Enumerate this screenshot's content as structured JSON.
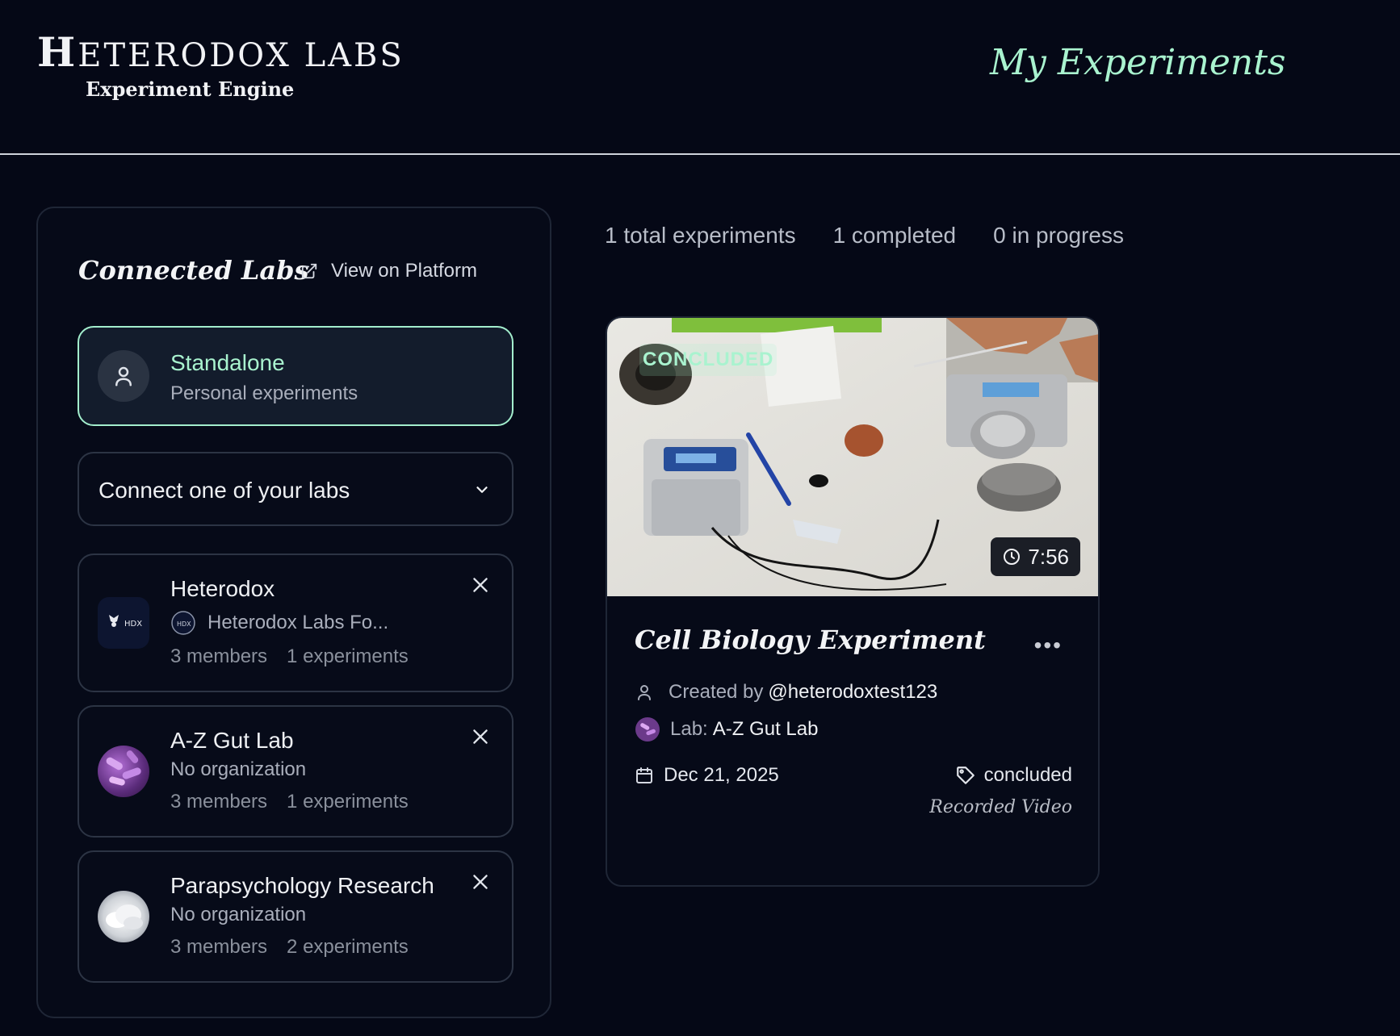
{
  "header": {
    "logo_initial": "H",
    "logo_rest": "ETERODOX LABS",
    "logo_subtitle": "Experiment Engine",
    "page_title": "My Experiments"
  },
  "sidebar": {
    "title": "Connected Labs",
    "view_platform": "View on Platform",
    "standalone": {
      "name": "Standalone",
      "subtitle": "Personal experiments"
    },
    "connect_placeholder": "Connect one of your labs",
    "labs": [
      {
        "name": "Heterodox",
        "org": "Heterodox Labs Fo...",
        "members": "3 members",
        "experiments": "1 experiments",
        "logo_text": "HDX"
      },
      {
        "name": "A-Z Gut Lab",
        "org": "No organization",
        "members": "3 members",
        "experiments": "1 experiments"
      },
      {
        "name": "Parapsychology Research",
        "org": "No organization",
        "members": "3 members",
        "experiments": "2 experiments"
      }
    ]
  },
  "summary": {
    "total": "1 total experiments",
    "completed": "1 completed",
    "in_progress": "0 in progress"
  },
  "experiment": {
    "status_badge": "CONCLUDED",
    "duration": "7:56",
    "title": "Cell Biology Experiment",
    "created_by_label": "Created by",
    "creator": "@heterodoxtest123",
    "lab_label": "Lab:",
    "lab": "A-Z Gut Lab",
    "date": "Dec 21, 2025",
    "tag": "concluded",
    "type": "Recorded Video"
  },
  "colors": {
    "accent": "#a9f3cf",
    "background": "#050816",
    "border": "#2c3444"
  }
}
